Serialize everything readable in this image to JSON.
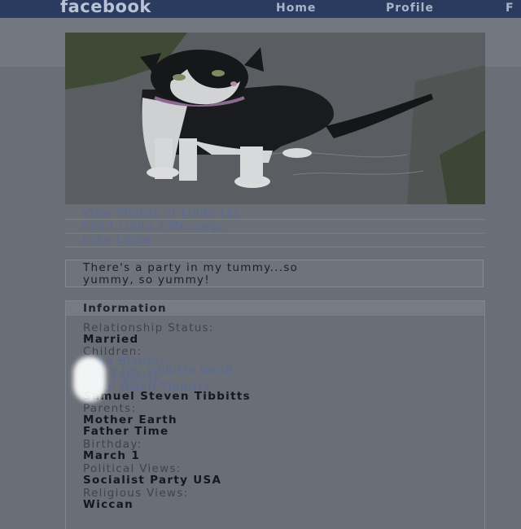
{
  "header": {
    "logo": "facebook",
    "nav": [
      "Home",
      "Profile",
      "F"
    ]
  },
  "profile": {
    "photo_subject": "cat",
    "actions": [
      "View Photos of Linda (1)",
      "Send Linda a Message",
      "Poke Linda"
    ],
    "status_line1": "There's a party in my tummy...so",
    "status_line2": "yummy, so yummy!"
  },
  "information": {
    "title": "Information",
    "relationship_label": "Relationship Status:",
    "relationship_value": "Married",
    "children_label": "Children:",
    "children": [
      "Josie Blanton",
      "EMily Joy Tibbitts Dodd",
      "Ray Tibbitts",
      "Keith Owen Tibbitts",
      "Samuel Steven Tibbitts"
    ],
    "parents_label": "Parents:",
    "parents": [
      "Mother Earth",
      "Father Time"
    ],
    "birthday_label": "Birthday:",
    "birthday_value": "March 1",
    "political_label": "Political Views:",
    "political_value": "Socialist Party USA",
    "religious_label": "Religious Views:",
    "religious_value": "Wiccan"
  }
}
